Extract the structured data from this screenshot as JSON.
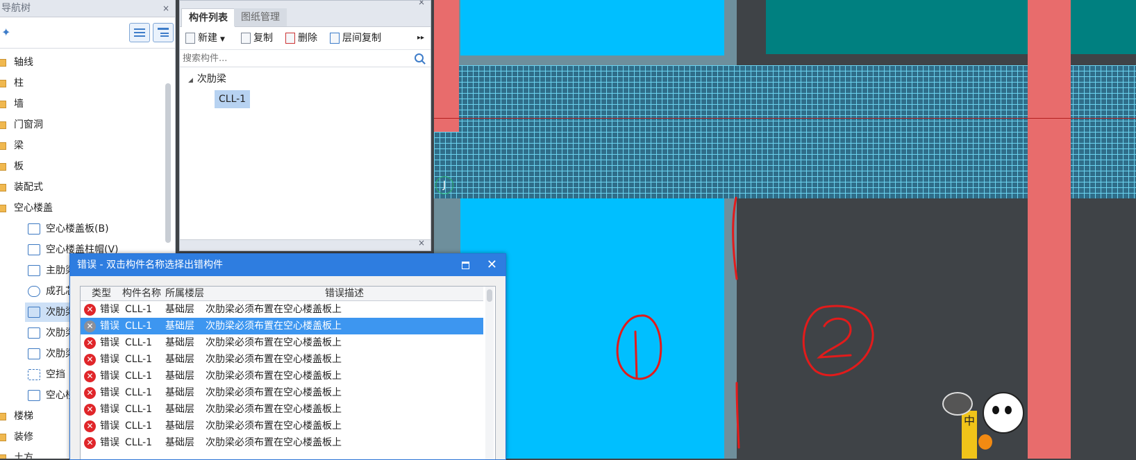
{
  "nav": {
    "header": "导航树",
    "close": "×",
    "items": [
      {
        "label": "轴线"
      },
      {
        "label": "柱"
      },
      {
        "label": "墙"
      },
      {
        "label": "门窗洞"
      },
      {
        "label": "梁"
      },
      {
        "label": "板"
      },
      {
        "label": "装配式"
      },
      {
        "label": "空心楼盖"
      }
    ],
    "sub_items": [
      {
        "label": "空心楼盖板(B)"
      },
      {
        "label": "空心楼盖柱帽(V)"
      },
      {
        "label": "主肋梁"
      },
      {
        "label": "成孔芯模"
      },
      {
        "label": "次肋梁"
      },
      {
        "label": "次肋梁"
      },
      {
        "label": "次肋梁"
      },
      {
        "label": "空挡"
      },
      {
        "label": "空心楼盖"
      }
    ],
    "bottom_items": [
      {
        "label": "楼梯"
      },
      {
        "label": "装修"
      },
      {
        "label": "土方"
      }
    ]
  },
  "component_panel": {
    "close": "×",
    "tabs": [
      {
        "label": "构件列表"
      },
      {
        "label": "图纸管理"
      }
    ],
    "toolbar": {
      "new": "新建",
      "copy": "复制",
      "delete": "删除",
      "floor_copy": "层间复制",
      "more": "▸▸"
    },
    "search_placeholder": "搜索构件...",
    "tree_parent": "次肋梁",
    "tree_child": "CLL-1"
  },
  "dialog": {
    "title": "错误 - 双击构件名称选择出错构件",
    "close": "✕",
    "columns": {
      "type": "类型",
      "name": "构件名称",
      "floor": "所属楼层",
      "desc": "错误描述"
    },
    "rows": [
      {
        "type": "错误",
        "name": "CLL-1",
        "floor": "基础层",
        "desc": "次肋梁必须布置在空心楼盖板上"
      },
      {
        "type": "错误",
        "name": "CLL-1",
        "floor": "基础层",
        "desc": "次肋梁必须布置在空心楼盖板上"
      },
      {
        "type": "错误",
        "name": "CLL-1",
        "floor": "基础层",
        "desc": "次肋梁必须布置在空心楼盖板上"
      },
      {
        "type": "错误",
        "name": "CLL-1",
        "floor": "基础层",
        "desc": "次肋梁必须布置在空心楼盖板上"
      },
      {
        "type": "错误",
        "name": "CLL-1",
        "floor": "基础层",
        "desc": "次肋梁必须布置在空心楼盖板上"
      },
      {
        "type": "错误",
        "name": "CLL-1",
        "floor": "基础层",
        "desc": "次肋梁必须布置在空心楼盖板上"
      },
      {
        "type": "错误",
        "name": "CLL-1",
        "floor": "基础层",
        "desc": "次肋梁必须布置在空心楼盖板上"
      },
      {
        "type": "错误",
        "name": "CLL-1",
        "floor": "基础层",
        "desc": "次肋梁必须布置在空心楼盖板上"
      },
      {
        "type": "错误",
        "name": "CLL-1",
        "floor": "基础层",
        "desc": "次肋梁必须布置在空心楼盖板上"
      }
    ],
    "selected_row": 1
  },
  "canvas": {
    "axis_label": "J",
    "ime_label": "中",
    "colors": {
      "slab": "#00bfff",
      "column": "#e86c6c",
      "teal": "#008080",
      "grid_line": "#6cd3ef",
      "annotation": "#e21b1b"
    }
  }
}
